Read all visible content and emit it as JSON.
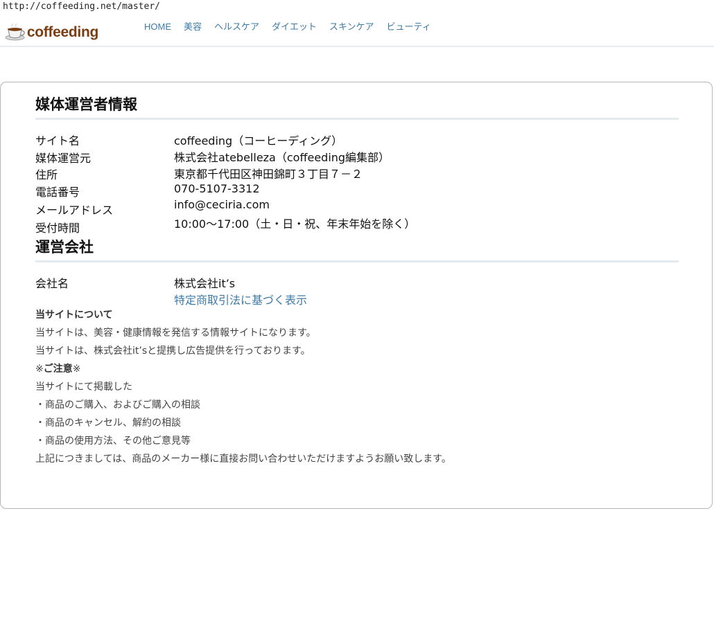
{
  "url": "http://coffeeding.net/master/",
  "logo": {
    "text": "coffeeding"
  },
  "nav": [
    "HOME",
    "美容",
    "ヘルスケア",
    "ダイエット",
    "スキンケア",
    "ビューティ"
  ],
  "section1": {
    "title": "媒体運営者情報",
    "rows": [
      {
        "label": "サイト名",
        "value": "coffeeding（コーヒーディング）"
      },
      {
        "label": "媒体運営元",
        "value": "株式会社atebelleza（coffeeding編集部）"
      },
      {
        "label": "住所",
        "value": "東京都千代田区神田錦町３丁目７－２"
      },
      {
        "label": "電話番号",
        "value": "070-5107-3312"
      },
      {
        "label": "メールアドレス",
        "value": "info@ceciria.com"
      },
      {
        "label": "受付時間",
        "value": "10:00～17:00（土・日・祝、年末年始を除く）"
      }
    ]
  },
  "section2": {
    "title": "運営会社",
    "company_label": "会社名",
    "company_value": "株式会社it’s",
    "link_text": "特定商取引法に基づく表示"
  },
  "about": {
    "heading": "当サイトについて",
    "line1": "当サイトは、美容・健康情報を発信する情報サイトになります。",
    "line2": "当サイトは、株式会社it’sと提携し広告提供を行っております。",
    "notice_prefix": "※",
    "notice_strong": "ご注意",
    "notice_suffix": "※",
    "line3": "当サイトにて掲載した",
    "bullet1": "・商品のご購入、およびご購入の相談",
    "bullet2": "・商品のキャンセル、解約の相談",
    "bullet3": "・商品の使用方法、その他ご意見等",
    "line4": "上記につきましては、商品のメーカー様に直接お問い合わせいただけますようお願い致します。"
  }
}
